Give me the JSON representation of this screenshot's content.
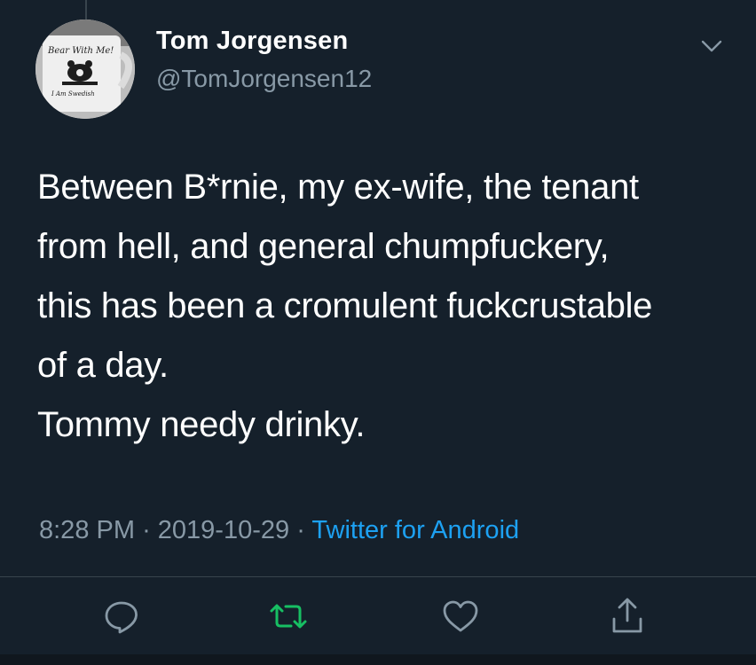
{
  "author": {
    "display_name": "Tom Jorgensen",
    "handle": "@TomJorgensen12",
    "avatar": {
      "description_icon": "mug-avatar",
      "mug_text_top": "Bear With Me!",
      "mug_text_bottom": "I Am Swedish"
    }
  },
  "tweet": {
    "text_lines": [
      "Between B*rnie, my ex-wife, the tenant",
      "from hell, and general chumpfuckery,",
      "this has been a cromulent fuckcrustable",
      "of a day.",
      "Tommy needy drinky."
    ],
    "time": "8:28 PM",
    "separator": "·",
    "date": "2019-10-29",
    "source": "Twitter for Android"
  },
  "actions": [
    {
      "name": "reply",
      "icon": "reply-icon"
    },
    {
      "name": "retweet",
      "icon": "retweet-icon",
      "color": "#17bf63"
    },
    {
      "name": "like",
      "icon": "heart-icon"
    },
    {
      "name": "share",
      "icon": "share-icon"
    }
  ],
  "colors": {
    "background": "#15202b",
    "secondary_text": "#8899a6",
    "link": "#1da1f2",
    "retweet_active": "#17bf63",
    "divider": "#38444d"
  }
}
